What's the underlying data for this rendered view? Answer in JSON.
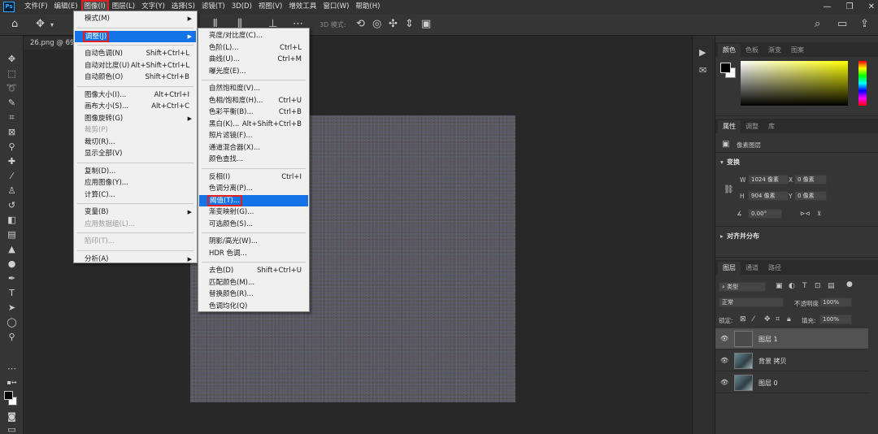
{
  "app": {
    "logo": "Ps"
  },
  "menubar": {
    "items": [
      "文件(F)",
      "编辑(E)",
      "图像(I)",
      "图层(L)",
      "文字(Y)",
      "选择(S)",
      "滤镜(T)",
      "3D(D)",
      "视图(V)",
      "增效工具",
      "窗口(W)",
      "帮助(H)"
    ],
    "active_index": 2
  },
  "window_controls": {
    "minimize": "—",
    "restore": "❐",
    "close": "✕"
  },
  "options_bar": {
    "mode_3d": "3D 模式:"
  },
  "document": {
    "tab_label": "26.png @ 69.5"
  },
  "image_menu": {
    "items": [
      {
        "label": "模式(M)",
        "shortcut": "",
        "submenu": true,
        "disabled": false
      },
      {
        "sep": true
      },
      {
        "label": "调整(J)",
        "shortcut": "",
        "submenu": true,
        "disabled": false,
        "highlighted": true,
        "boxed": true
      },
      {
        "sep": true
      },
      {
        "label": "自动色调(N)",
        "shortcut": "Shift+Ctrl+L"
      },
      {
        "label": "自动对比度(U)",
        "shortcut": "Alt+Shift+Ctrl+L"
      },
      {
        "label": "自动颜色(O)",
        "shortcut": "Shift+Ctrl+B"
      },
      {
        "sep": true
      },
      {
        "label": "图像大小(I)...",
        "shortcut": "Alt+Ctrl+I"
      },
      {
        "label": "画布大小(S)...",
        "shortcut": "Alt+Ctrl+C"
      },
      {
        "label": "图像旋转(G)",
        "shortcut": "",
        "submenu": true
      },
      {
        "label": "裁剪(P)",
        "shortcut": "",
        "disabled": true
      },
      {
        "label": "裁切(R)...",
        "shortcut": ""
      },
      {
        "label": "显示全部(V)",
        "shortcut": ""
      },
      {
        "sep": true
      },
      {
        "label": "复制(D)...",
        "shortcut": ""
      },
      {
        "label": "应用图像(Y)...",
        "shortcut": ""
      },
      {
        "label": "计算(C)...",
        "shortcut": ""
      },
      {
        "sep": true
      },
      {
        "label": "变量(B)",
        "shortcut": "",
        "submenu": true
      },
      {
        "label": "应用数据组(L)...",
        "shortcut": "",
        "disabled": true
      },
      {
        "sep": true
      },
      {
        "label": "陷印(T)...",
        "shortcut": "",
        "disabled": true
      },
      {
        "sep": true
      },
      {
        "label": "分析(A)",
        "shortcut": "",
        "submenu": true
      }
    ]
  },
  "adjust_menu": {
    "items": [
      {
        "label": "亮度/对比度(C)...",
        "shortcut": ""
      },
      {
        "label": "色阶(L)...",
        "shortcut": "Ctrl+L"
      },
      {
        "label": "曲线(U)...",
        "shortcut": "Ctrl+M"
      },
      {
        "label": "曝光度(E)...",
        "shortcut": ""
      },
      {
        "sep": true
      },
      {
        "label": "自然饱和度(V)...",
        "shortcut": ""
      },
      {
        "label": "色相/饱和度(H)...",
        "shortcut": "Ctrl+U"
      },
      {
        "label": "色彩平衡(B)...",
        "shortcut": "Ctrl+B"
      },
      {
        "label": "黑白(K)...",
        "shortcut": "Alt+Shift+Ctrl+B"
      },
      {
        "label": "照片滤镜(F)...",
        "shortcut": ""
      },
      {
        "label": "通道混合器(X)...",
        "shortcut": ""
      },
      {
        "label": "颜色查找...",
        "shortcut": ""
      },
      {
        "sep": true
      },
      {
        "label": "反相(I)",
        "shortcut": "Ctrl+I"
      },
      {
        "label": "色调分离(P)...",
        "shortcut": ""
      },
      {
        "label": "阈值(T)...",
        "shortcut": "",
        "highlighted": true,
        "boxed": true
      },
      {
        "label": "渐变映射(G)...",
        "shortcut": ""
      },
      {
        "label": "可选颜色(S)...",
        "shortcut": ""
      },
      {
        "sep": true
      },
      {
        "label": "阴影/高光(W)...",
        "shortcut": ""
      },
      {
        "label": "HDR 色调...",
        "shortcut": ""
      },
      {
        "sep": true
      },
      {
        "label": "去色(D)",
        "shortcut": "Shift+Ctrl+U"
      },
      {
        "label": "匹配颜色(M)...",
        "shortcut": ""
      },
      {
        "label": "替换颜色(R)...",
        "shortcut": ""
      },
      {
        "label": "色调均化(Q)",
        "shortcut": ""
      }
    ]
  },
  "color_panel": {
    "tabs": [
      "颜色",
      "色板",
      "渐变",
      "图案"
    ],
    "active_tab": 0
  },
  "properties_panel": {
    "tabs": [
      "属性",
      "调整",
      "库"
    ],
    "active_tab": 0,
    "layer_type": "像素图层",
    "transform_title": "变换",
    "w_label": "W",
    "w_value": "1024 像素",
    "h_label": "H",
    "h_value": "904 像素",
    "x_label": "X",
    "x_value": "0 像素",
    "y_label": "Y",
    "y_value": "0 像素",
    "angle_value": "0.00°",
    "align_title": "对齐并分布"
  },
  "layers_panel": {
    "tabs": [
      "图层",
      "通道",
      "路径"
    ],
    "active_tab": 0,
    "filter_kind": "类型",
    "blend_mode": "正常",
    "opacity_label": "不透明度:",
    "opacity_value": "100%",
    "lock_label": "锁定:",
    "fill_label": "填充:",
    "fill_value": "100%",
    "layers": [
      {
        "name": "图层 1",
        "selected": true,
        "thumb": "blank"
      },
      {
        "name": "背景 拷贝",
        "selected": false,
        "thumb": "image"
      },
      {
        "name": "图层 0",
        "selected": false,
        "thumb": "image"
      }
    ]
  }
}
